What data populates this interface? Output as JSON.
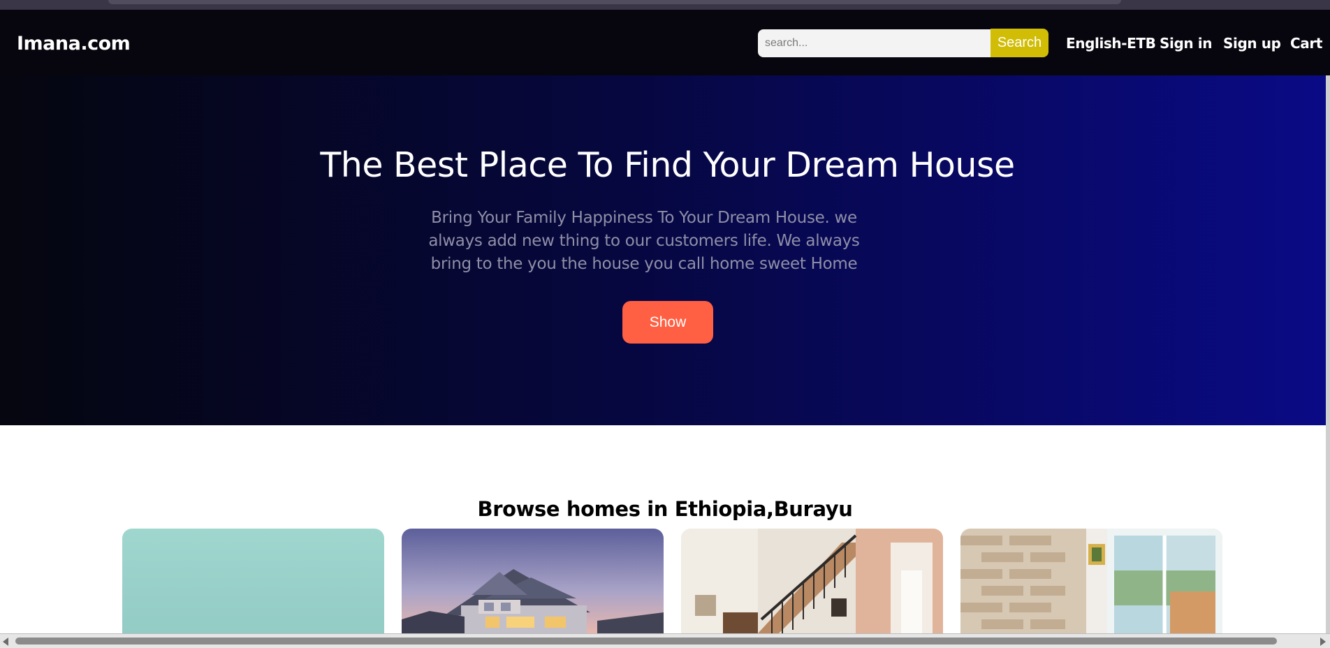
{
  "navbar": {
    "brand": "Imana.com",
    "search_placeholder": "search...",
    "search_button": "Search",
    "links": {
      "language": "English-ETB",
      "sign_in": "Sign in",
      "sign_up": "Sign up",
      "cart": "Cart"
    }
  },
  "hero": {
    "title": "The Best Place To Find Your Dream House",
    "text": "Bring Your Family Happiness To Your Dream House. we always add new thing to our customers life. We always bring to the you the house you call home sweet Home",
    "button": "Show"
  },
  "browse": {
    "title": "Browse homes in Ethiopia,Burayu"
  },
  "colors": {
    "navbar_bg": "#07060e",
    "search_button": "#d1bd05",
    "show_button": "#ff5f42",
    "hero_gradient_end": "#0a0a86"
  }
}
